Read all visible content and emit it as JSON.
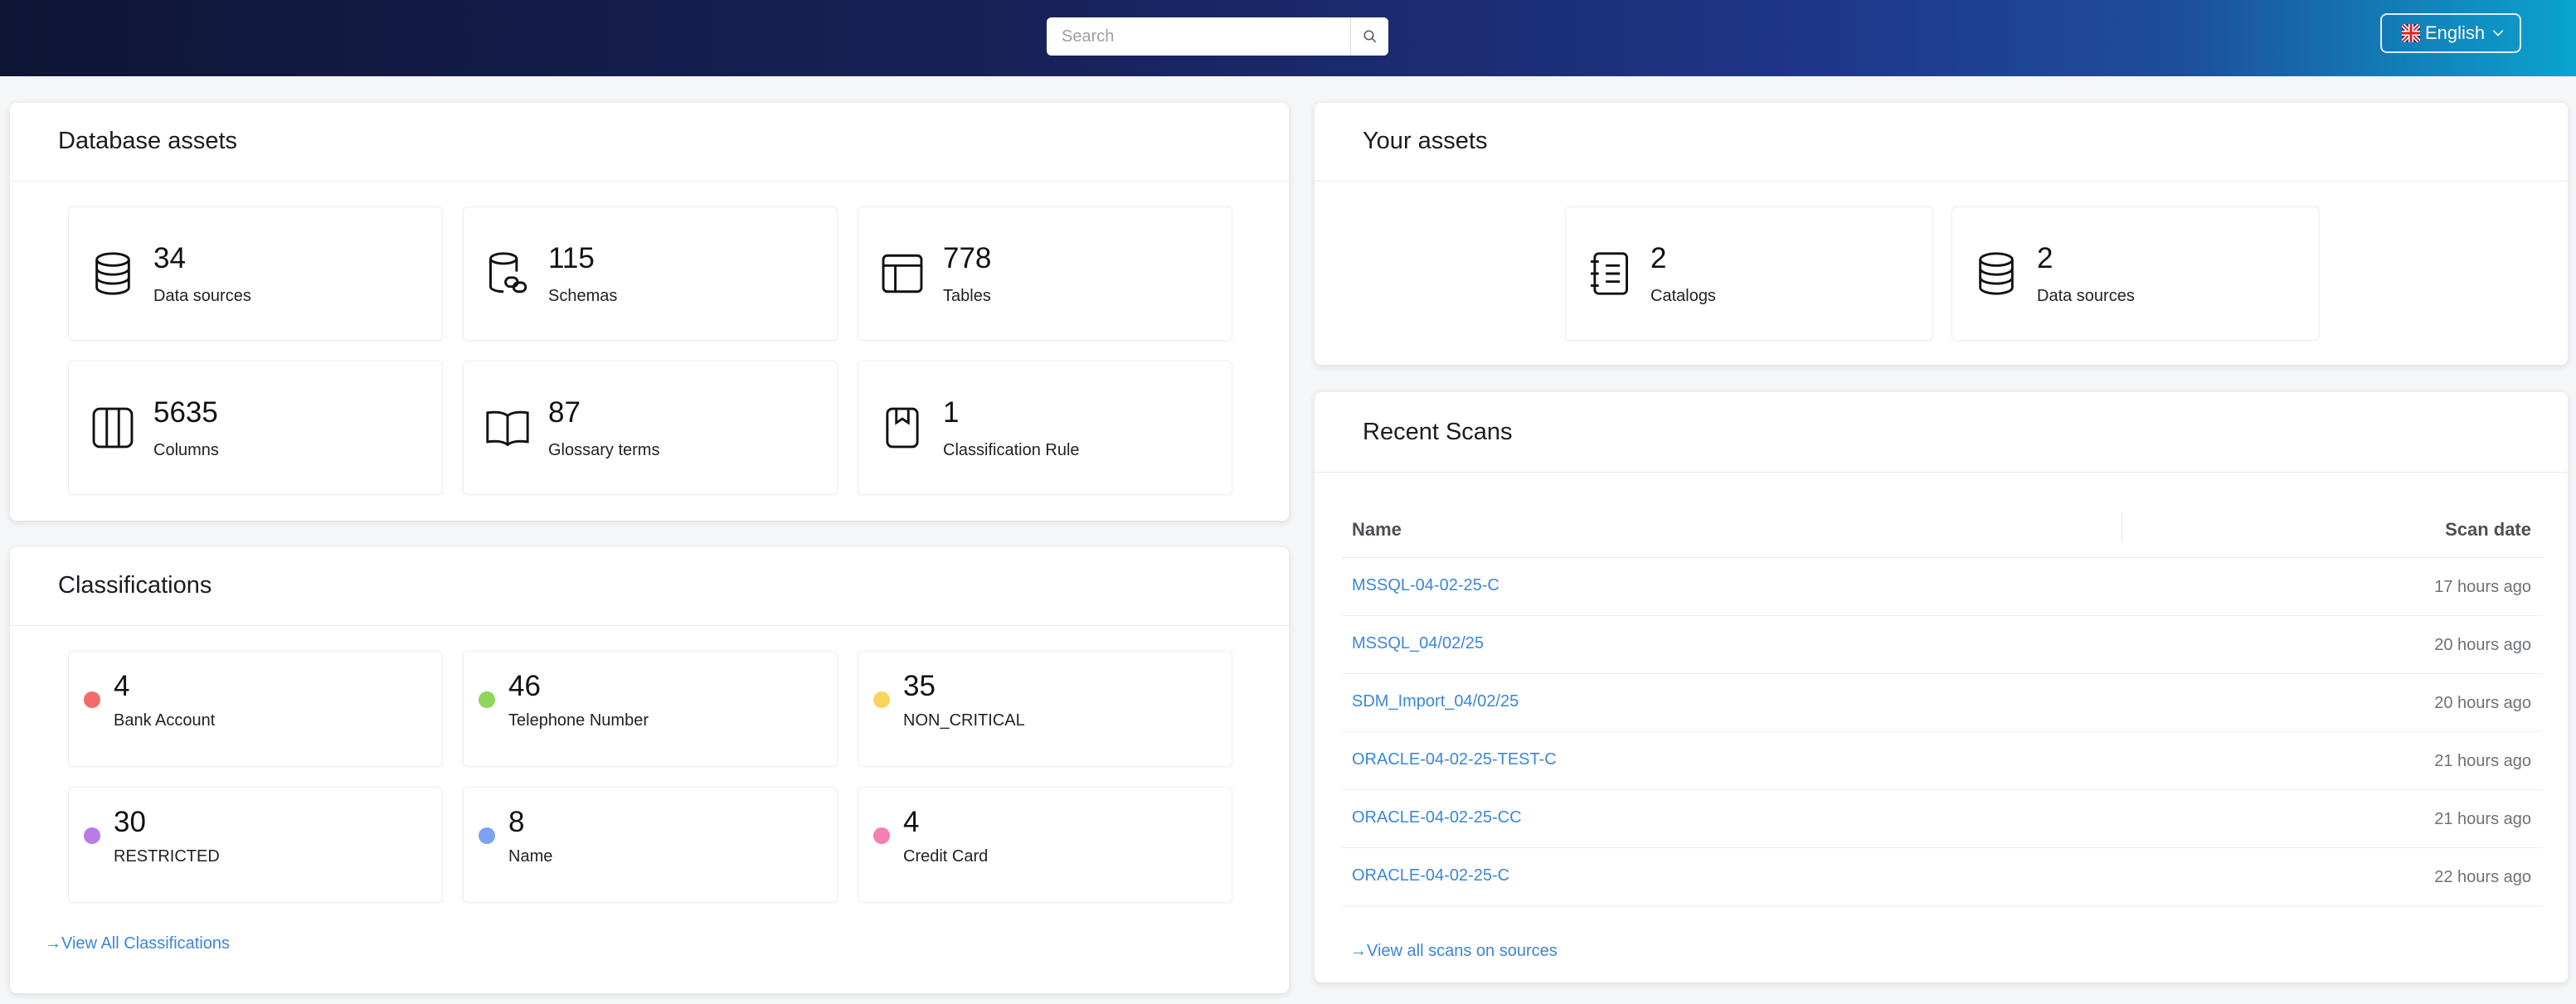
{
  "header": {
    "search_placeholder": "Search",
    "language_label": "English"
  },
  "database_assets": {
    "title": "Database assets",
    "tiles": [
      {
        "value": "34",
        "label": "Data sources",
        "icon": "database-icon"
      },
      {
        "value": "115",
        "label": "Schemas",
        "icon": "schema-link-icon"
      },
      {
        "value": "778",
        "label": "Tables",
        "icon": "table-icon"
      },
      {
        "value": "5635",
        "label": "Columns",
        "icon": "columns-icon"
      },
      {
        "value": "87",
        "label": "Glossary terms",
        "icon": "book-icon"
      },
      {
        "value": "1",
        "label": "Classification Rule",
        "icon": "bookmark-icon"
      }
    ]
  },
  "your_assets": {
    "title": "Your assets",
    "tiles": [
      {
        "value": "2",
        "label": "Catalogs",
        "icon": "notebook-icon"
      },
      {
        "value": "2",
        "label": "Data sources",
        "icon": "database-icon"
      }
    ]
  },
  "classifications": {
    "title": "Classifications",
    "items": [
      {
        "value": "4",
        "label": "Bank Account",
        "color": "#f26b6b"
      },
      {
        "value": "46",
        "label": "Telephone Number",
        "color": "#8fd65a"
      },
      {
        "value": "35",
        "label": "NON_CRITICAL",
        "color": "#f9d560"
      },
      {
        "value": "30",
        "label": "RESTRICTED",
        "color": "#b97be8"
      },
      {
        "value": "8",
        "label": "Name",
        "color": "#7ba3f0"
      },
      {
        "value": "4",
        "label": "Credit Card",
        "color": "#f57eb6"
      }
    ],
    "view_all_label": "View All Classifications"
  },
  "recent_scans": {
    "title": "Recent Scans",
    "columns": {
      "name": "Name",
      "date": "Scan date"
    },
    "rows": [
      {
        "name": "MSSQL-04-02-25-C",
        "date": "17 hours ago"
      },
      {
        "name": "MSSQL_04/02/25",
        "date": "20 hours ago"
      },
      {
        "name": "SDM_Import_04/02/25",
        "date": "20 hours ago"
      },
      {
        "name": "ORACLE-04-02-25-TEST-C",
        "date": "21 hours ago"
      },
      {
        "name": "ORACLE-04-02-25-CC",
        "date": "21 hours ago"
      },
      {
        "name": "ORACLE-04-02-25-C",
        "date": "22 hours ago"
      }
    ],
    "view_all_label": "View all scans on sources"
  },
  "colors": {
    "accent_link": "#3b86d8",
    "header_gradient_start": "#0f1535",
    "header_gradient_end": "#0aa4cf"
  }
}
